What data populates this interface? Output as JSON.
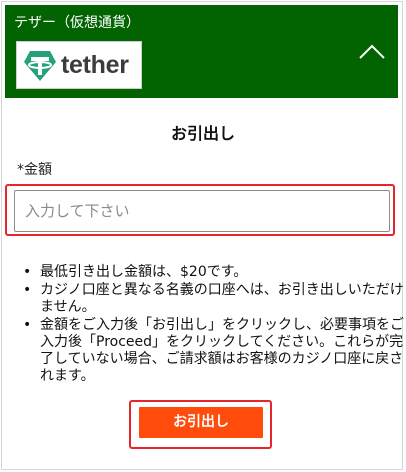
{
  "section": {
    "title": "テザー（仮想通貨）",
    "logo_text": "tether",
    "collapse_icon": "chevron-up-icon"
  },
  "form": {
    "page_title": "お引出し",
    "amount_label": "*金額",
    "amount_value": "",
    "amount_placeholder": "入力して下さい",
    "submit_label": "お引出し"
  },
  "notes": [
    "最低引き出し金額は、$20です。",
    "カジノ口座と異なる名義の口座へは、お引き出しいただけません。",
    "金額をご入力後「お引出し」をクリックし、必要事項をご入力後「Proceed」をクリックしてください。これらが完了していない場合、ご請求額はお客様のカジノ口座に戻されます。"
  ],
  "colors": {
    "header_bg": "#016400",
    "tether_green": "#26a17b",
    "button_bg": "#ff4b0c",
    "highlight_red": "#e5262a"
  }
}
